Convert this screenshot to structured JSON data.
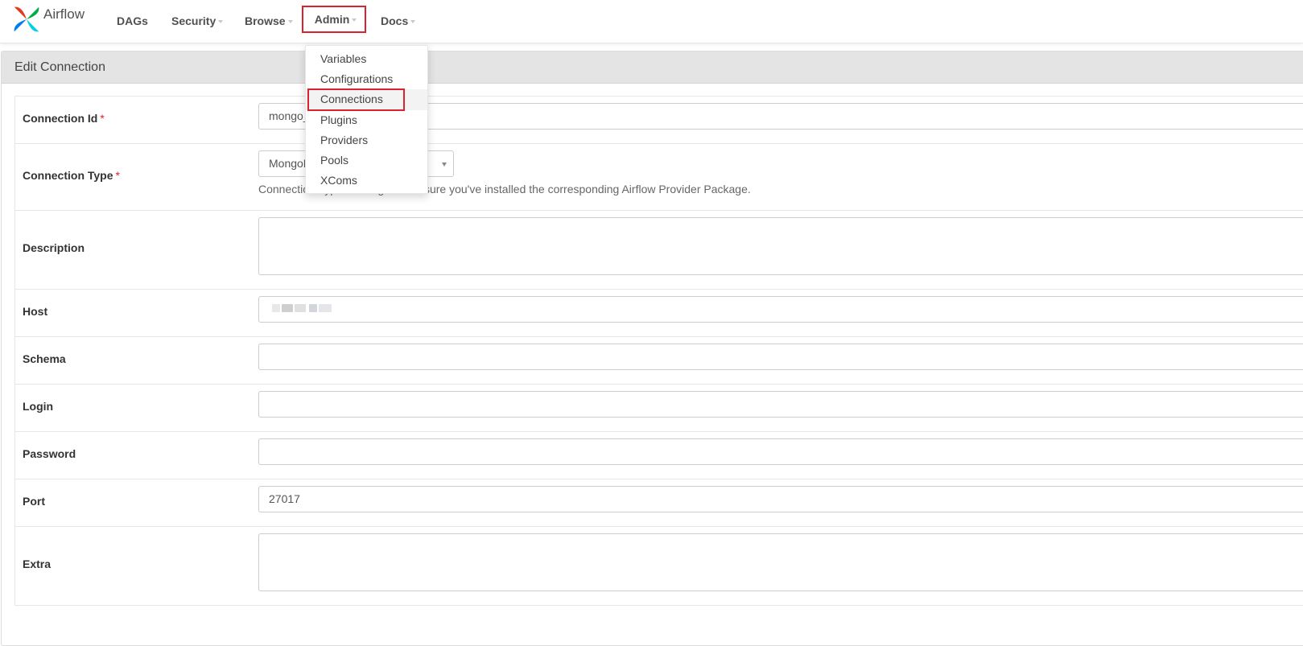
{
  "app": {
    "brand_name": "Airflow",
    "accent_color": "#d9232e"
  },
  "nav": {
    "dags": "DAGs",
    "security": "Security",
    "browse": "Browse",
    "admin": "Admin",
    "docs": "Docs"
  },
  "admin_menu": {
    "items": [
      "Variables",
      "Configurations",
      "Connections",
      "Plugins",
      "Providers",
      "Pools",
      "XComs"
    ],
    "highlighted": "Connections"
  },
  "panel": {
    "title": "Edit Connection"
  },
  "form": {
    "connection_id": {
      "label": "Connection Id",
      "required_mark": "*",
      "value": "mongo_"
    },
    "connection_type": {
      "label": "Connection Type",
      "required_mark": "*",
      "selected": "MongoDB",
      "help": "Connection Type missing? Make sure you've installed the corresponding Airflow Provider Package."
    },
    "description": {
      "label": "Description",
      "value": ""
    },
    "host": {
      "label": "Host",
      "value": ""
    },
    "schema": {
      "label": "Schema",
      "value": ""
    },
    "login": {
      "label": "Login",
      "value": ""
    },
    "password": {
      "label": "Password",
      "value": ""
    },
    "port": {
      "label": "Port",
      "value": "27017"
    },
    "extra": {
      "label": "Extra",
      "value": ""
    }
  },
  "icons": {
    "brand": "airflow-pinwheel-icon",
    "caret": "caret-down-icon"
  }
}
